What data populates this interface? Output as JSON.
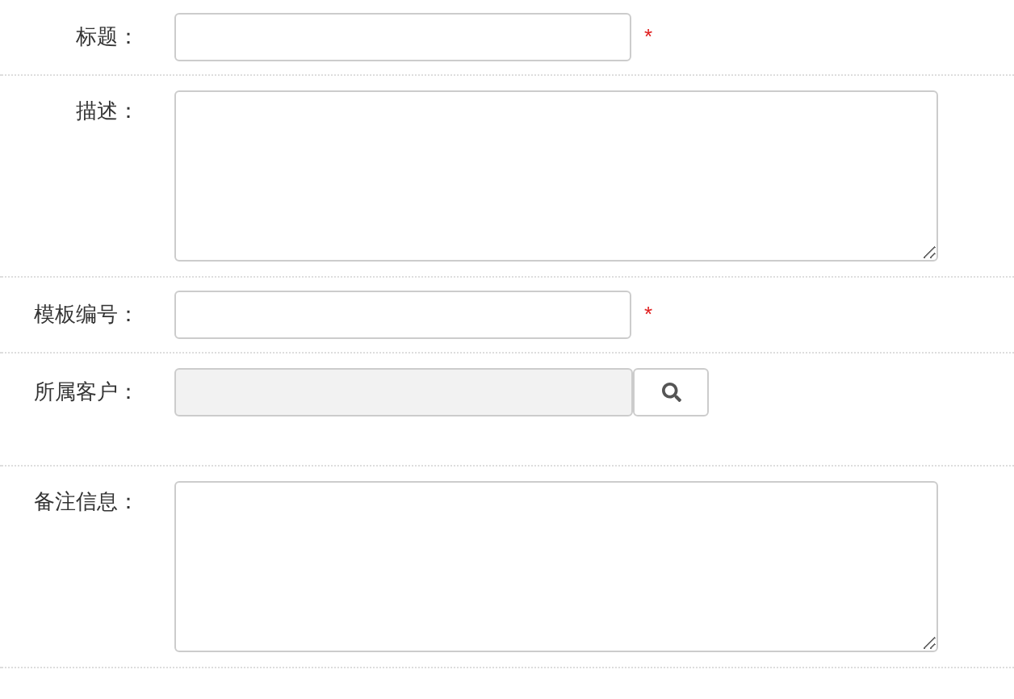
{
  "fields": [
    {
      "kind": "text",
      "label": "标题：",
      "required_mark": "*"
    },
    {
      "kind": "textarea",
      "label": "描述："
    },
    {
      "kind": "text",
      "label": "模板编号：",
      "required_mark": "*"
    },
    {
      "kind": "lookup",
      "label": "所属客户：",
      "disabled": true
    },
    {
      "kind": "textarea",
      "label": "备注信息："
    }
  ]
}
